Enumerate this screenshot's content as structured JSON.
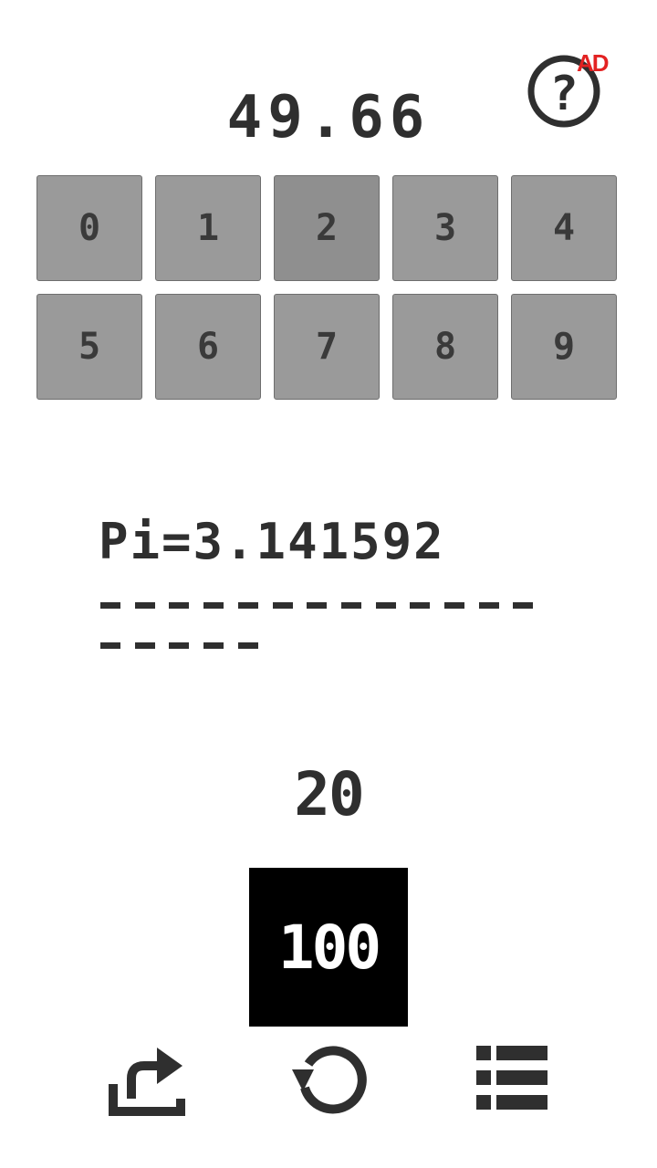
{
  "header": {
    "timer": "49.66",
    "help_icon": "question-circle-icon",
    "ad_label": "AD"
  },
  "keypad": {
    "keys": [
      "0",
      "1",
      "2",
      "3",
      "4",
      "5",
      "6",
      "7",
      "8",
      "9"
    ],
    "pressed_key": "2"
  },
  "prompt": {
    "text": "Pi=3.141592",
    "blank_rows": [
      13,
      5
    ]
  },
  "score": "20",
  "goal": "100",
  "toolbar": {
    "share_icon": "share-icon",
    "restart_icon": "restart-icon",
    "menu_icon": "list-menu-icon"
  },
  "colors": {
    "key_bg": "#9a9a9a",
    "text": "#2f2f2f",
    "ad": "#e32222"
  }
}
